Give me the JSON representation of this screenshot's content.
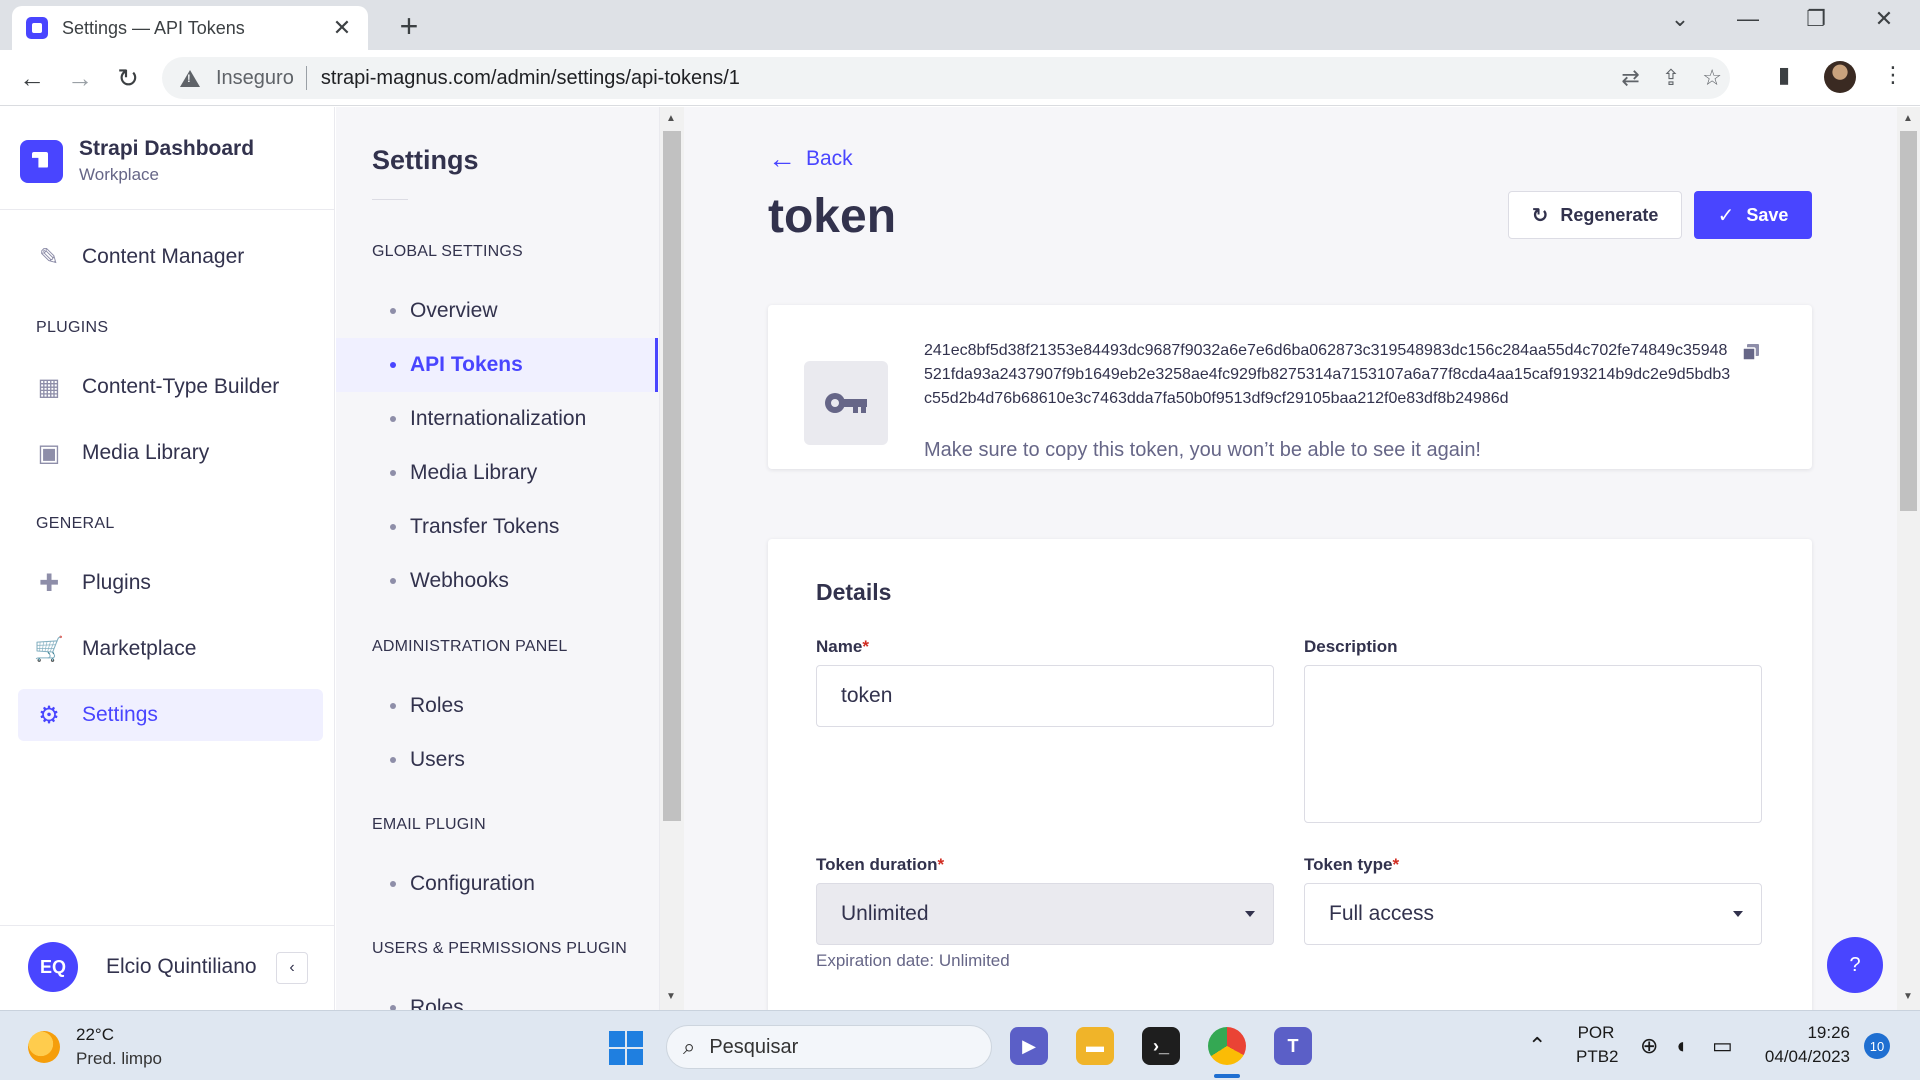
{
  "browser": {
    "tab_title": "Settings — API Tokens",
    "security_label": "Inseguro",
    "url": "strapi-magnus.com/admin/settings/api-tokens/1",
    "icons": [
      "back-arrow-icon",
      "forward-arrow-icon",
      "reload-icon",
      "translate-icon",
      "share-icon",
      "star-icon",
      "sidepanel-icon",
      "menu-dots-icon"
    ]
  },
  "mainnav": {
    "brand_name": "Strapi Dashboard",
    "brand_sub": "Workplace",
    "items": [
      {
        "label": "Content Manager",
        "icon": "pencil-icon"
      },
      {
        "label": "Content-Type Builder",
        "icon": "layout-icon"
      },
      {
        "label": "Media Library",
        "icon": "image-icon"
      },
      {
        "label": "Plugins",
        "icon": "puzzle-icon"
      },
      {
        "label": "Marketplace",
        "icon": "cart-icon"
      },
      {
        "label": "Settings",
        "icon": "gear-icon"
      }
    ],
    "sections": [
      "PLUGINS",
      "GENERAL"
    ],
    "user_initials": "EQ",
    "user_name": "Elcio Quintiliano"
  },
  "subnav": {
    "title": "Settings",
    "sections": [
      "GLOBAL SETTINGS",
      "ADMINISTRATION PANEL",
      "EMAIL PLUGIN",
      "USERS & PERMISSIONS PLUGIN"
    ],
    "global": [
      "Overview",
      "API Tokens",
      "Internationalization",
      "Media Library",
      "Transfer Tokens",
      "Webhooks"
    ],
    "admin": [
      "Roles",
      "Users"
    ],
    "email": [
      "Configuration"
    ],
    "users_permissions": [
      "Roles"
    ]
  },
  "main": {
    "back_label": "Back",
    "title": "token",
    "regenerate_label": "Regenerate",
    "save_label": "Save",
    "token_value": "241ec8bf5d38f21353e84493dc9687f9032a6e7e6d6ba062873c319548983dc156c284aa55d4c702fe74849c35948521fda93a2437907f9b1649eb2e3258ae4fc929fb8275314a7153107a6a77f8cda4aa15caf9193214b9dc2e9d5bdb3c55d2b4d76b68610e3c7463dda7fa50b0f9513df9cf29105baa212f0e83df8b24986d",
    "token_hint": "Make sure to copy this token, you won’t be able to see it again!",
    "details_title": "Details",
    "name_label": "Name",
    "name_value": "token",
    "description_label": "Description",
    "description_value": "",
    "duration_label": "Token duration",
    "duration_value": "Unlimited",
    "duration_hint": "Expiration date: Unlimited",
    "type_label": "Token type",
    "type_value": "Full access",
    "required_mark": "*",
    "help_label": "?"
  },
  "taskbar": {
    "temperature": "22°C",
    "weather": "Pred. limpo",
    "search_placeholder": "Pesquisar",
    "lang_top": "POR",
    "lang_bottom": "PTB2",
    "time": "19:26",
    "date": "04/04/2023",
    "notifications": "10"
  },
  "colors": {
    "accent": "#4945ff",
    "danger": "#d02b20",
    "neutral_bg": "#f6f6f9"
  }
}
